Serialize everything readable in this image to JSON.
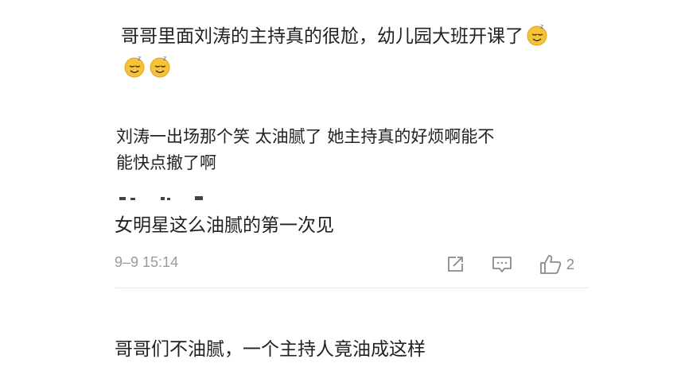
{
  "comments": [
    {
      "text": "哥哥里面刘涛的主持真的很尬，幼儿园大班开课了",
      "emojis": [
        "sleepy-face-icon",
        "sleepy-face-icon",
        "sleepy-face-icon"
      ]
    },
    {
      "text_line1": "刘涛一出场那个笑 太油腻了  她主持真的好烦啊能不",
      "text_line2": "能快点撤了啊"
    },
    {
      "text": "女明星这么油腻的第一次见",
      "date": "9–9 15:14",
      "likes": "2"
    },
    {
      "text": "哥哥们不油腻，一个主持人竟油成这样"
    }
  ],
  "colors": {
    "text": "#222222",
    "meta": "#9a9a9a",
    "icon": "#8a8a8a",
    "emoji": "#f6c23a"
  }
}
